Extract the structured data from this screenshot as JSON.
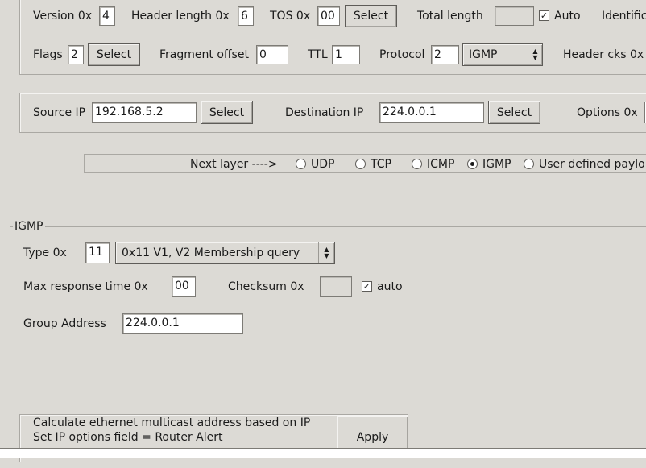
{
  "ip": {
    "version_label": "Version 0x",
    "version_value": "4",
    "header_length_label": "Header length 0x",
    "header_length_value": "6",
    "tos_label": "TOS 0x",
    "tos_value": "00",
    "tos_select": "Select",
    "total_length_label": "Total length",
    "total_length_value": "",
    "auto_label": "Auto",
    "ident_label": "Identific",
    "flags_label": "Flags",
    "flags_value": "2",
    "flags_select": "Select",
    "frag_label": "Fragment offset",
    "frag_value": "0",
    "ttl_label": "TTL",
    "ttl_value": "1",
    "protocol_label": "Protocol",
    "protocol_value": "2",
    "protocol_combo": "IGMP",
    "header_cks_label": "Header cks 0x",
    "source_label": "Source IP",
    "source_value": "192.168.5.2",
    "source_select": "Select",
    "dest_label": "Destination IP",
    "dest_value": "224.0.0.1",
    "dest_select": "Select",
    "options_label": "Options 0x"
  },
  "next_layer": {
    "label": "Next layer  ---->",
    "udp": "UDP",
    "tcp": "TCP",
    "icmp": "ICMP",
    "igmp": "IGMP",
    "user": "User defined paylo",
    "selected": "IGMP"
  },
  "igmp": {
    "title": "IGMP",
    "type_label": "Type  0x",
    "type_value": "11",
    "type_combo": "0x11   V1, V2 Membership query",
    "max_resp_label": "Max response time  0x",
    "max_resp_value": "00",
    "checksum_label": "Checksum  0x",
    "checksum_value": "",
    "auto_label": "auto",
    "group_label": "Group Address",
    "group_value": "224.0.0.1",
    "calc_line1": "Calculate ethernet multicast address based on IP",
    "calc_line2": "Set IP options field = Router Alert",
    "apply": "Apply"
  }
}
